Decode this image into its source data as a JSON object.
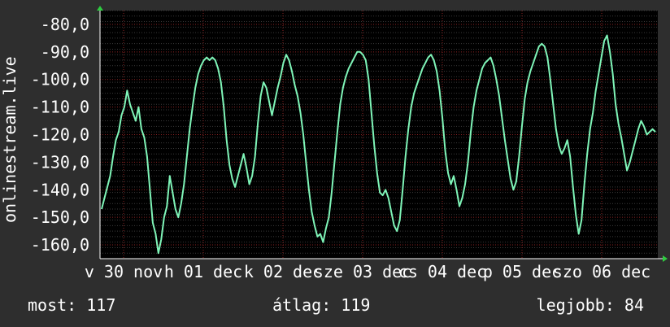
{
  "chart_data": {
    "type": "line",
    "ylabel": "onlinestream.live",
    "ylim": [
      -165,
      -75
    ],
    "y_ticks": [
      -80,
      -90,
      -100,
      -110,
      -120,
      -130,
      -140,
      -150,
      -160
    ],
    "y_tick_labels": [
      "-80,0",
      "-90,0",
      "-100,0",
      "-110,0",
      "-120,0",
      "-130,0",
      "-140,0",
      "-150,0",
      "-160,0"
    ],
    "x_tick_labels": [
      "v 30 nov",
      "h 01 dec",
      "k 02 dec",
      "sze 03 dec",
      "cs 04 dec",
      "p 05 dec",
      "szo 06 dec"
    ],
    "grid": true,
    "line_color": "#7ff5b8",
    "grid_color": "#8a2222",
    "series": [
      {
        "values": [
          -147,
          -143,
          -139,
          -135,
          -128,
          -122,
          -119,
          -113,
          -110,
          -104,
          -109,
          -112,
          -115,
          -110,
          -118,
          -121,
          -128,
          -140,
          -152,
          -156,
          -163,
          -158,
          -150,
          -146,
          -135,
          -141,
          -147,
          -150,
          -145,
          -138,
          -128,
          -118,
          -110,
          -103,
          -98,
          -95,
          -93,
          -92,
          -93,
          -92,
          -93,
          -96,
          -101,
          -110,
          -122,
          -131,
          -136,
          -139,
          -135,
          -131,
          -127,
          -132,
          -138,
          -135,
          -128,
          -116,
          -106,
          -101,
          -103,
          -108,
          -113,
          -108,
          -103,
          -99,
          -94,
          -91,
          -93,
          -97,
          -102,
          -106,
          -112,
          -120,
          -130,
          -140,
          -148,
          -153,
          -157,
          -156,
          -159,
          -154,
          -150,
          -141,
          -130,
          -119,
          -109,
          -103,
          -99,
          -96,
          -94,
          -92,
          -90,
          -90,
          -91,
          -93,
          -100,
          -112,
          -124,
          -134,
          -141,
          -142,
          -140,
          -143,
          -148,
          -153,
          -155,
          -151,
          -140,
          -128,
          -118,
          -110,
          -105,
          -102,
          -99,
          -96,
          -94,
          -92,
          -91,
          -93,
          -97,
          -104,
          -114,
          -126,
          -134,
          -138,
          -135,
          -140,
          -146,
          -143,
          -138,
          -130,
          -119,
          -110,
          -104,
          -100,
          -96,
          -94,
          -93,
          -92,
          -95,
          -100,
          -106,
          -114,
          -122,
          -129,
          -136,
          -140,
          -137,
          -128,
          -117,
          -107,
          -101,
          -97,
          -94,
          -91,
          -88,
          -87,
          -88,
          -92,
          -100,
          -109,
          -118,
          -124,
          -127,
          -125,
          -122,
          -128,
          -139,
          -149,
          -156,
          -151,
          -138,
          -127,
          -118,
          -112,
          -104,
          -98,
          -92,
          -86,
          -84,
          -90,
          -98,
          -109,
          -116,
          -121,
          -127,
          -133,
          -130,
          -126,
          -122,
          -118,
          -115,
          -117,
          -120,
          -119,
          -118,
          -119
        ]
      }
    ]
  },
  "stats": {
    "most": "most: 117",
    "atlag": "átlag: 119",
    "legjobb": "legjobb: 84"
  }
}
